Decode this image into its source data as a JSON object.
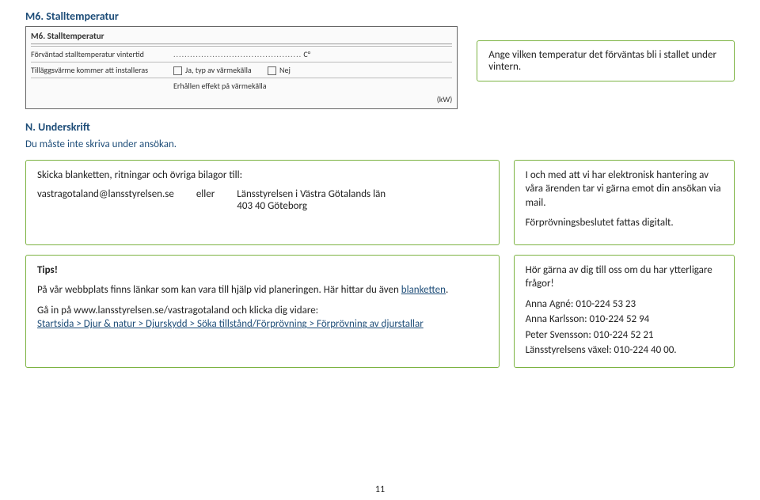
{
  "section1": {
    "heading": "M6. Stalltemperatur"
  },
  "form": {
    "title": "M6. Stalltemperatur",
    "row1_label": "Förväntad stalltemperatur vintertid",
    "row1_unit": "C°",
    "row2_label": "Tilläggsvärme kommer att installeras",
    "row2_yes": "Ja, typ av värmekälla",
    "row2_no": "Nej",
    "row3_label": "Erhållen effekt på värmekälla",
    "row3_unit": "(kW)"
  },
  "note1": {
    "text": "Ange vilken temperatur det förväntas bli i stallet under vintern."
  },
  "section_und": {
    "heading": "N. Underskrift",
    "text": "Du måste inte skriva under ansökan."
  },
  "send": {
    "label": "Skicka blanketten, ritningar och övriga bilagor till:",
    "email": "vastragotaland@lansstyrelsen.se",
    "eller": "eller",
    "addr1": "Länsstyrelsen i Västra Götalands län",
    "addr2": "403 40 Göteborg"
  },
  "einfo": {
    "p1": "I och med att vi har elektronisk hantering av våra ärenden tar vi gärna emot din ansökan via mail.",
    "p2": "Förprövningsbeslutet fattas digitalt."
  },
  "tips": {
    "heading": "Tips!",
    "p1a": "På vår webbplats finns länkar som kan vara till hjälp vid planeringen. Här hittar du även ",
    "blanketten": "blanketten",
    "p1c": ".",
    "p2a": "Gå in på www.lansstyrelsen.se/vastragotaland och klicka dig vidare:",
    "p2link": "Startsida > Djur & natur > Djurskydd > Söka tillstånd/Förprövning > Förprövning av djurstallar"
  },
  "contact": {
    "p1": "Hör gärna av dig till oss om du har ytterligare frågor!",
    "c1": "Anna Agné: 010-224 53 23",
    "c2": "Anna Karlsson: 010-224 52 94",
    "c3": "Peter Svensson: 010-224 52 21",
    "c4": "Länsstyrelsens växel: 010-224 40 00."
  },
  "page_number": "11"
}
